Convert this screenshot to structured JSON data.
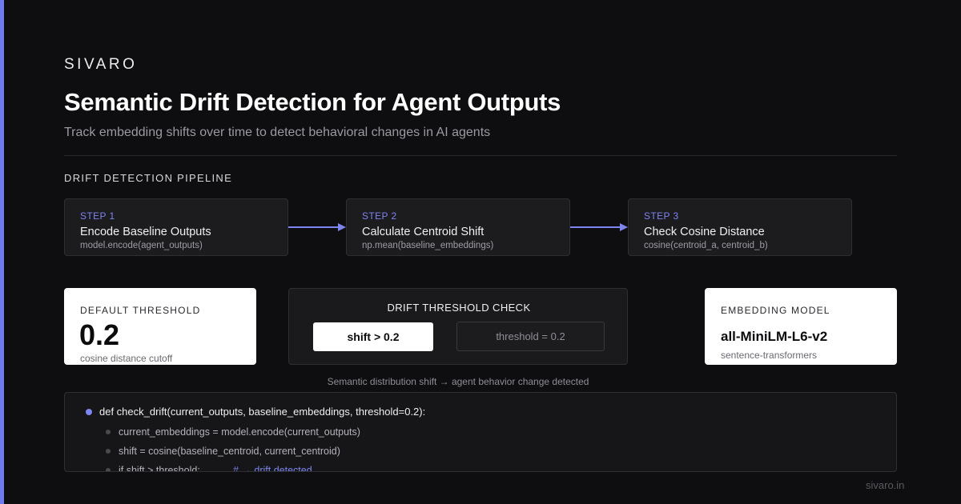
{
  "colors": {
    "accent": "#6f7bf0",
    "background": "#0e0e10",
    "card": "#1c1c1f",
    "white_card": "#ffffff"
  },
  "brand": "SIVARO",
  "title": "Semantic Drift Detection for Agent Outputs",
  "subtitle": "Track embedding shifts over time to detect behavioral changes in AI agents",
  "pipeline": {
    "section_label": "DRIFT DETECTION PIPELINE",
    "steps": [
      {
        "label": "STEP 1",
        "name": "Encode Baseline Outputs",
        "code": "model.encode(agent_outputs)"
      },
      {
        "label": "STEP 2",
        "name": "Calculate Centroid Shift",
        "code": "np.mean(baseline_embeddings)"
      },
      {
        "label": "STEP 3",
        "name": "Check Cosine Distance",
        "code": "cosine(centroid_a, centroid_b)"
      }
    ]
  },
  "threshold_card": {
    "label": "DEFAULT THRESHOLD",
    "value": "0.2",
    "sub": "cosine distance cutoff"
  },
  "check_card": {
    "title": "DRIFT THRESHOLD CHECK",
    "condition": "shift > 0.2",
    "threshold": "threshold = 0.2"
  },
  "model_card": {
    "label": "EMBEDDING MODEL",
    "value": "all-MiniLM-L6-v2",
    "sub": "sentence-transformers"
  },
  "caption": "Semantic distribution shift → agent behavior change detected",
  "code": {
    "signature": "def check_drift(current_outputs, baseline_embeddings, threshold=0.2):",
    "lines": [
      "current_embeddings = model.encode(current_outputs)",
      "shift = cosine(baseline_centroid, current_centroid)",
      "if shift > threshold:"
    ],
    "comment": "# → drift detected"
  },
  "footer": "sivaro.in"
}
